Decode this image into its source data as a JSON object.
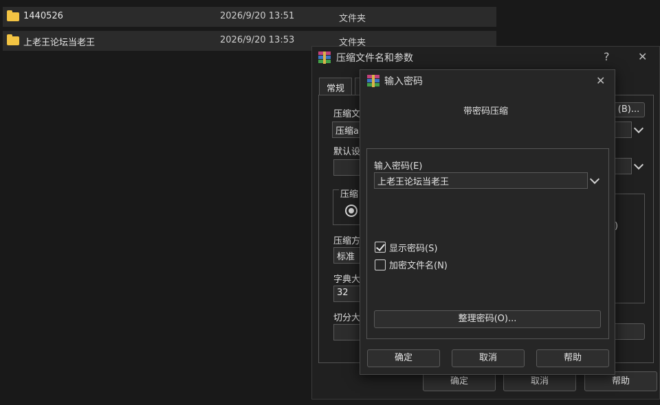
{
  "file_list": {
    "rows": [
      {
        "name": "1440526",
        "date": "2026/9/20 13:51",
        "type": "文件夹"
      },
      {
        "name": "上老王论坛当老王",
        "date": "2026/9/20 13:53",
        "type": "文件夹"
      }
    ]
  },
  "archive_dialog": {
    "title": "压缩文件名和参数",
    "help_glyph": "?",
    "close_glyph": "✕",
    "tab_general": "常规",
    "archive_name_label": "压缩文",
    "archive_name_value": "压缩a",
    "browse_button": "(B)...",
    "default_label": "默认设",
    "compress_format_group": "压缩",
    "method_label": "压缩方",
    "method_value": "标准",
    "dict_label": "字典大",
    "dict_value": "32",
    "split_label": "切分大",
    "partial_paren": ")",
    "ok_button": "确定",
    "cancel_button": "取消",
    "help_button": "帮助"
  },
  "password_dialog": {
    "title": "输入密码",
    "close_glyph": "✕",
    "heading": "带密码压缩",
    "password_label": "输入密码(E)",
    "password_value": "上老王论坛当老王",
    "show_password_label": "显示密码(S)",
    "show_password_checked": true,
    "encrypt_names_label": "加密文件名(N)",
    "encrypt_names_checked": false,
    "organize_button": "整理密码(O)...",
    "ok_button": "确定",
    "cancel_button": "取消",
    "help_button": "帮助"
  }
}
